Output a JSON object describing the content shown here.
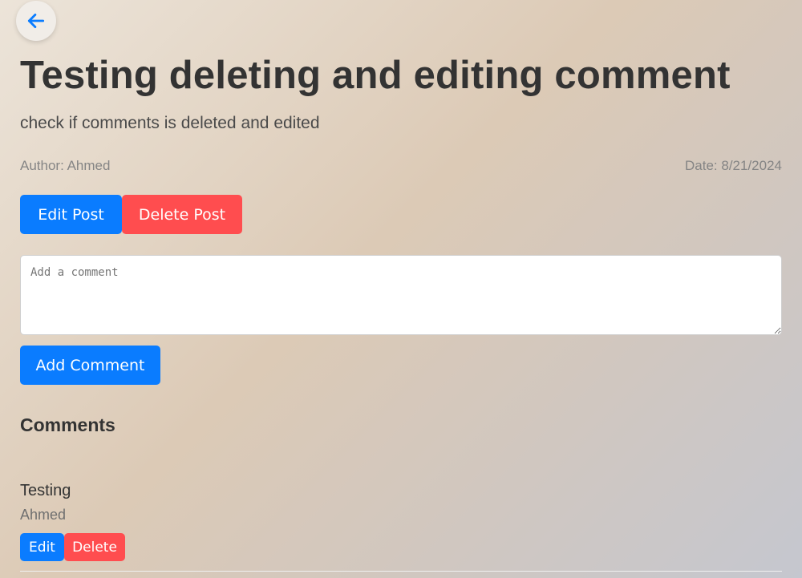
{
  "post": {
    "title": "Testing deleting and editing comment",
    "description": "check if comments is deleted and edited",
    "author": "Author: Ahmed",
    "date": "Date: 8/21/2024"
  },
  "actions": {
    "edit_post_label": "Edit Post",
    "delete_post_label": "Delete Post"
  },
  "comment_form": {
    "placeholder": "Add a comment",
    "value": "",
    "submit_label": "Add Comment"
  },
  "comments_section": {
    "heading": "Comments",
    "items": [
      {
        "text": "Testing",
        "author": "Ahmed",
        "edit_label": "Edit",
        "delete_label": "Delete"
      }
    ]
  },
  "icons": {
    "back": "arrow-left-icon"
  },
  "colors": {
    "primary": "#0a7cff",
    "danger": "#ff4d4f",
    "title_text": "#333333",
    "muted_text": "#858585"
  }
}
